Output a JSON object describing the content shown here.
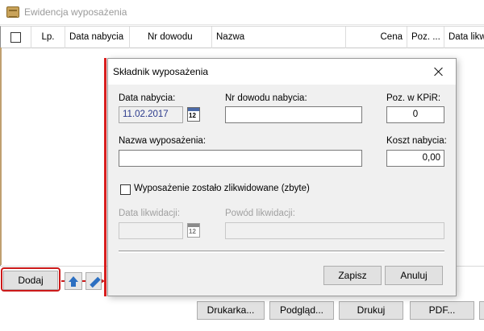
{
  "window": {
    "title": "Ewidencja wyposażenia"
  },
  "grid": {
    "columns": [
      "Lp.",
      "Data nabycia",
      "Nr dowodu",
      "Nazwa",
      "Cena",
      "Poz. ...",
      "Data likw"
    ],
    "rows": []
  },
  "toolbar": {
    "add_label": "Dodaj",
    "printer_label": "Drukarka...",
    "preview_label": "Podgląd...",
    "print_label": "Drukuj",
    "pdf_label": "PDF..."
  },
  "dialog": {
    "title": "Składnik wyposażenia",
    "purchase_date_label": "Data nabycia:",
    "purchase_date_value": "11.02.2017",
    "calendar_icon_text": "12",
    "document_number_label": "Nr dowodu nabycia:",
    "document_number_value": "",
    "kpir_position_label": "Poz. w KPiR:",
    "kpir_position_value": "0",
    "item_name_label": "Nazwa wyposażenia:",
    "item_name_value": "",
    "purchase_cost_label": "Koszt nabycia:",
    "purchase_cost_value": "0,00",
    "liquidated_checkbox_label": "Wyposażenie zostało zlikwidowane (zbyte)",
    "liquidated_checked": false,
    "liquidation_date_label": "Data likwidacji:",
    "liquidation_date_value": "",
    "liquidation_reason_label": "Powód likwidacji:",
    "liquidation_reason_value": "",
    "save_label": "Zapisz",
    "cancel_label": "Anuluj"
  },
  "colors": {
    "highlight": "#cc1a1a",
    "accent_blue": "#2c6fc1"
  }
}
